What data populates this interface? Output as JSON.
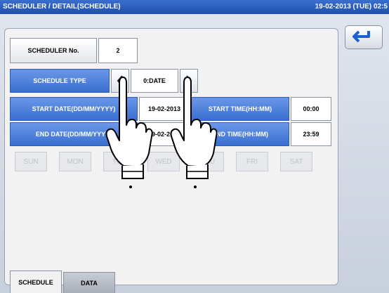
{
  "header": {
    "title": "SCHEDULER / DETAIL(SCHEDULE)",
    "datetime": "19-02-2013 (TUE) 02:5"
  },
  "scheduler_no": {
    "label": "SCHEDULER No.",
    "value": "2"
  },
  "schedule_type": {
    "label": "SCHEDULE TYPE",
    "value": "0:DATE"
  },
  "start": {
    "date_label": "START DATE(DD/MM/YYYY)",
    "date_value": "19-02-2013",
    "time_label": "START TIME(HH:MM)",
    "time_value": "00:00"
  },
  "end": {
    "date_label": "END DATE(DD/MM/YYYY)",
    "date_value": "19-02-2013",
    "time_label": "END TIME(HH:MM)",
    "time_value": "23:59"
  },
  "days": [
    "SUN",
    "MON",
    "TUE",
    "WED",
    "THU",
    "FRI",
    "SAT"
  ],
  "tabs": {
    "schedule": "SCHEDULE",
    "data": "DATA"
  },
  "icons": {
    "back": "back-arrow-icon",
    "prev": "chevron-left-icon",
    "next": "chevron-right-icon",
    "hand": "pointing-hand-icon"
  },
  "colors": {
    "accent": "#3a6ed0",
    "title_bar": "#1f4fae",
    "back_arrow": "#1e5fd0"
  }
}
